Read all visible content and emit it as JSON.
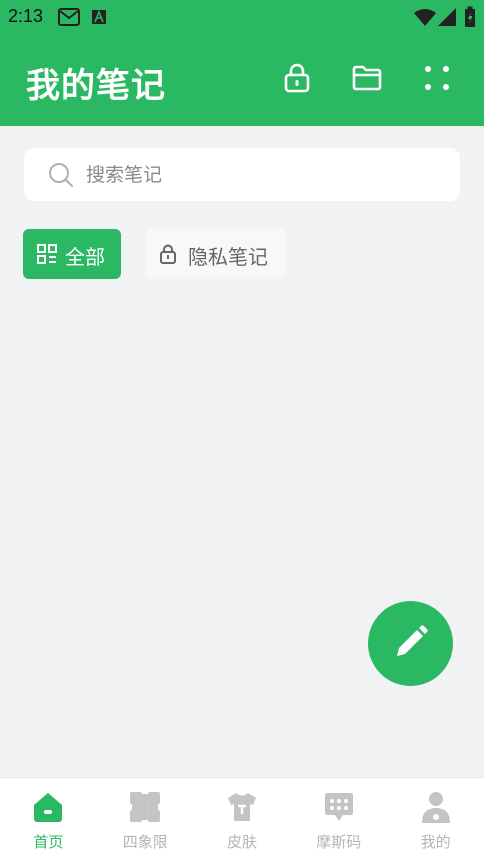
{
  "status_bar": {
    "time": "2:13"
  },
  "header": {
    "title": "我的笔记",
    "actions": [
      {
        "icon": "lock-icon"
      },
      {
        "icon": "folder-icon"
      },
      {
        "icon": "grid-dots-icon"
      }
    ]
  },
  "search": {
    "placeholder": "搜索笔记",
    "value": ""
  },
  "categories": [
    {
      "label": "全部",
      "icon": "grid-icon",
      "active": true
    },
    {
      "label": "隐私笔记",
      "icon": "lock-icon",
      "active": false
    }
  ],
  "fab": {
    "icon": "pencil-icon"
  },
  "bottom_nav": [
    {
      "label": "首页",
      "icon": "home-icon",
      "active": true
    },
    {
      "label": "四象限",
      "icon": "quadrant-icon",
      "active": false
    },
    {
      "label": "皮肤",
      "icon": "tshirt-icon",
      "active": false
    },
    {
      "label": "摩斯码",
      "icon": "message-icon",
      "active": false
    },
    {
      "label": "我的",
      "icon": "user-icon",
      "active": false
    }
  ],
  "colors": {
    "primary": "#2bb863",
    "background": "#f1f2f4",
    "inactive_nav": "#b5b5b5"
  }
}
